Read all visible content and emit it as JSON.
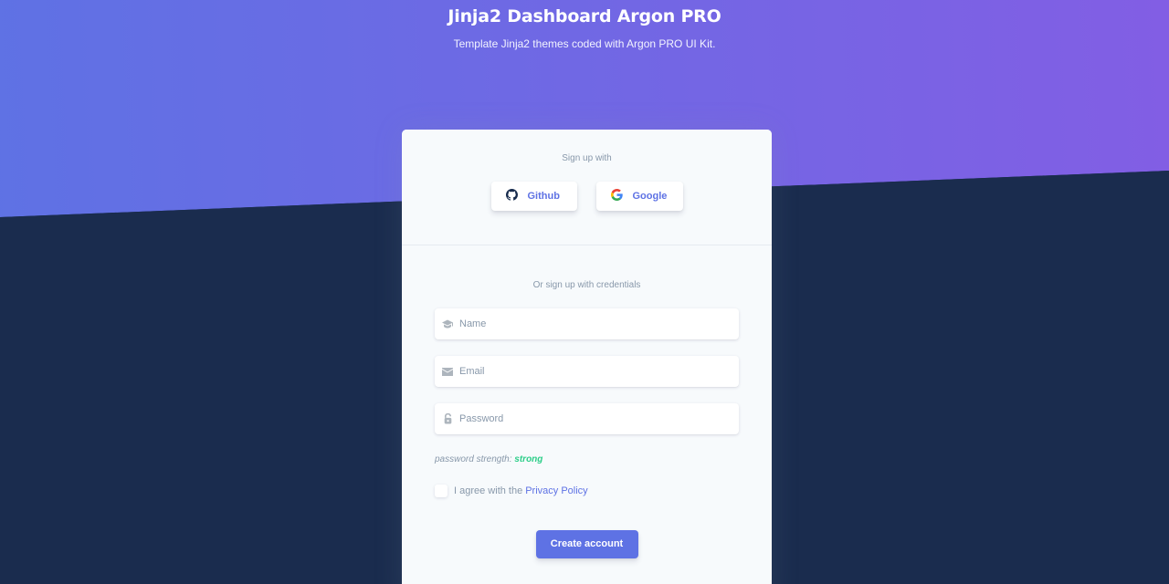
{
  "header": {
    "title": "Jinja2 Dashboard Argon PRO",
    "subtitle": "Template Jinja2 themes coded with Argon PRO UI Kit."
  },
  "social": {
    "heading": "Sign up with",
    "github_label": "Github",
    "google_label": "Google"
  },
  "form": {
    "heading": "Or sign up with credentials",
    "name_placeholder": "Name",
    "email_placeholder": "Email",
    "password_placeholder": "Password",
    "strength_label": "password strength:",
    "strength_value": "strong",
    "agree_text": "I agree with the",
    "privacy_link": "Privacy Policy",
    "submit_label": "Create account"
  },
  "colors": {
    "primary": "#5e72e4",
    "gradient_end": "#825ee4",
    "success": "#2dce89",
    "dark_bg": "#1a2c4e"
  },
  "icons": {
    "name_field": "graduation-cap-icon",
    "email_field": "envelope-icon",
    "password_field": "lock-open-icon"
  }
}
